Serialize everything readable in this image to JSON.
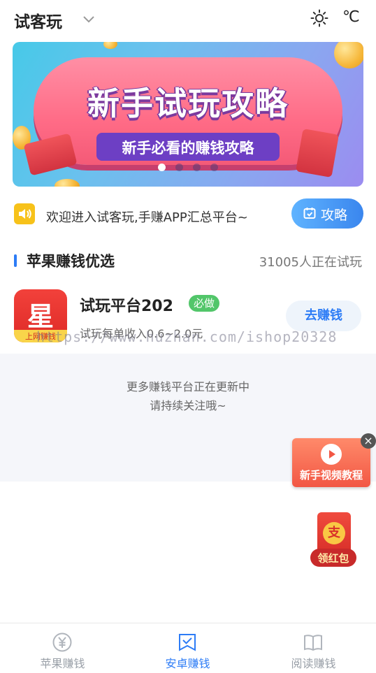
{
  "header": {
    "title": "试客玩",
    "temp_unit": "℃"
  },
  "banner": {
    "title": "新手试玩攻略",
    "subtitle": "新手必看的赚钱攻略"
  },
  "notice": {
    "text": "欢迎进入试客玩,手赚APP汇总平台~",
    "guide_label": "攻略"
  },
  "section": {
    "title": "苹果赚钱优选",
    "count_text": "31005人正在试玩"
  },
  "list": {
    "items": [
      {
        "name": "试玩平台202",
        "badge": "必做",
        "desc": "试玩每单收入0.6~2.0元",
        "button": "去赚钱",
        "logo_char": "星",
        "logo_text": "上网赚钱"
      }
    ]
  },
  "watermark": "https://www.huzhan.com/ishop20328",
  "more": {
    "line1": "更多赚钱平台正在更新中",
    "line2": "请持续关注哦~"
  },
  "float": {
    "video_label": "新手视频教程",
    "close": "×",
    "packet_label": "领红包",
    "packet_char": "支"
  },
  "nav": {
    "items": [
      {
        "label": "苹果赚钱"
      },
      {
        "label": "安卓赚钱"
      },
      {
        "label": "阅读赚钱"
      }
    ]
  },
  "colors": {
    "accent": "#2d7cf6",
    "badge_green": "#52c66a",
    "notice_yellow": "#f7c21a"
  }
}
